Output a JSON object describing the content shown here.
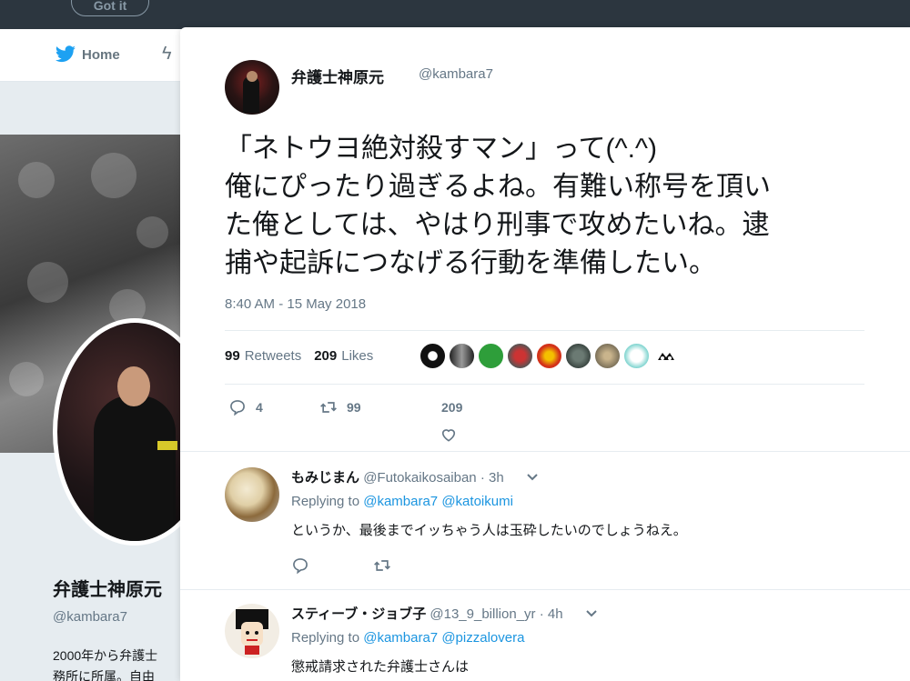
{
  "topbar": {
    "gotit_label": "Got it"
  },
  "nav": {
    "home_label": "Home"
  },
  "profile": {
    "name": "弁護士神原元",
    "handle": "@kambara7",
    "bio_line1": "2000年から弁護士",
    "bio_line2": "務所に所属。自由"
  },
  "tweet": {
    "author_name": "弁護士神原元",
    "author_handle": "@kambara7",
    "text_line1": "「ネトウヨ絶対殺すマン」って(^.^)",
    "text_line2": "俺にぴったり過ぎるよね。有難い称号を頂い",
    "text_line3": "た俺としては、やはり刑事で攻めたいね。逮",
    "text_line4": "捕や起訴につなげる行動を準備したい。",
    "timestamp": "8:40 AM - 15 May 2018",
    "retweets_count": "99",
    "retweets_label": "Retweets",
    "likes_count": "209",
    "likes_label": "Likes",
    "reply_count": "4",
    "retweet_count": "99",
    "like_count": "209"
  },
  "replies": [
    {
      "name": "もみじまん",
      "handle": "@Futokaikosaiban",
      "time": "· 3h",
      "replying_prefix": "Replying to",
      "mention1": "@kambara7",
      "mention2": "@katoikumi",
      "text": "というか、最後までイッちゃう人は玉砕したいのでしょうねえ。"
    },
    {
      "name": "スティーブ・ジョブ子",
      "handle": "@13_9_billion_yr",
      "time": "· 4h",
      "replying_prefix": "Replying to",
      "mention1": "@kambara7",
      "mention2": "@pizzalovera",
      "text": "懲戒請求された弁護士さんは"
    }
  ],
  "colors": {
    "link": "#1b95e0",
    "muted": "#657786",
    "twitter_blue": "#1da1f2",
    "topbar": "#2c363f"
  }
}
